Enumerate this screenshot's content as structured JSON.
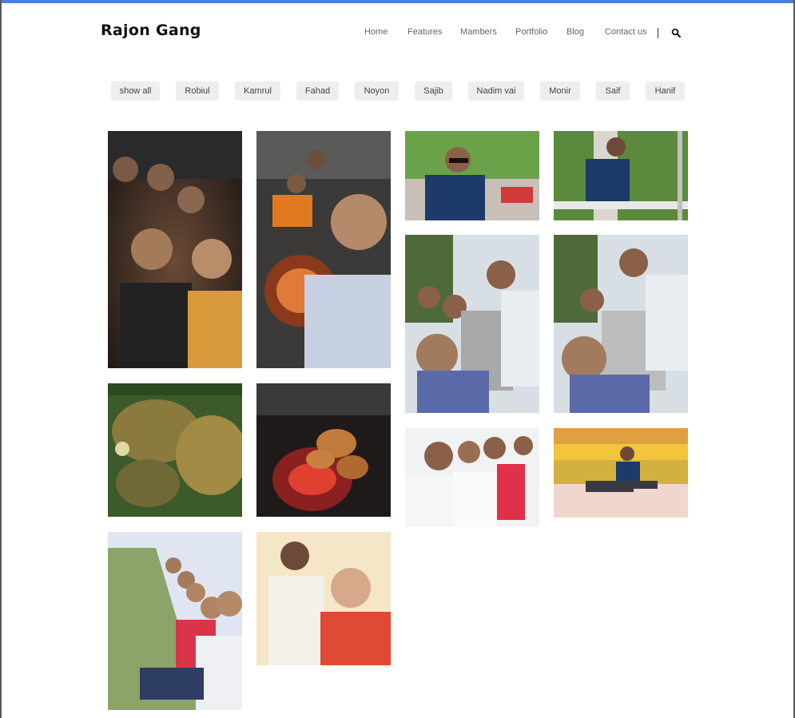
{
  "brand": {
    "name": "Rajon Gang"
  },
  "nav": {
    "items": [
      "Home",
      "Features",
      "Mambers",
      "Portfolio",
      "Blog",
      "Contact us"
    ],
    "search_icon": "search-icon"
  },
  "filters": [
    "show all",
    "Robiul",
    "Kamrul",
    "Fahad",
    "Noyon",
    "Sajib",
    "Nadim vai",
    "Monir",
    "Saif",
    "Hanif"
  ],
  "colors": {
    "accent": "#4a7ed9",
    "filter_bg": "#eeeeee",
    "nav_text": "#666666"
  },
  "gallery": {
    "photos": [
      {
        "name": "night-group-selfie"
      },
      {
        "name": "bbq-group-selfie"
      },
      {
        "name": "sunglasses-portrait"
      },
      {
        "name": "railing-portrait"
      },
      {
        "name": "river-selfie-1"
      },
      {
        "name": "river-selfie-2"
      },
      {
        "name": "food-on-leaf"
      },
      {
        "name": "grill-close-up"
      },
      {
        "name": "group-selfie-outdoors"
      },
      {
        "name": "sitting-portrait-yellow-wall"
      },
      {
        "name": "grass-group-selfie"
      },
      {
        "name": "two-friends-selfie"
      }
    ]
  }
}
